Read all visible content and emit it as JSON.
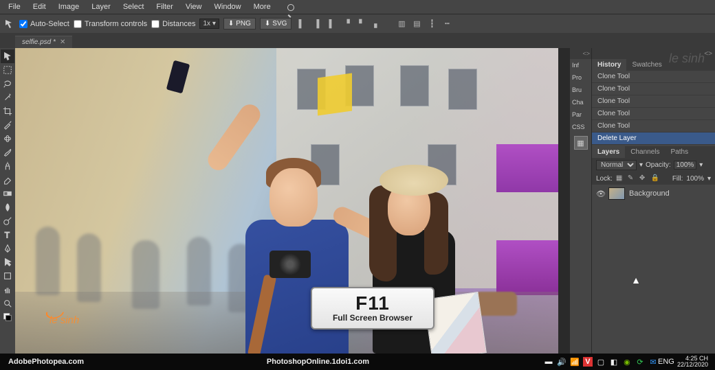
{
  "menu": {
    "items": [
      "File",
      "Edit",
      "Image",
      "Layer",
      "Select",
      "Filter",
      "View",
      "Window",
      "More"
    ]
  },
  "options": {
    "autoSelect": "Auto-Select",
    "transformControls": "Transform controls",
    "distances": "Distances",
    "scale": "1x",
    "png": "PNG",
    "svg": "SVG"
  },
  "tab": {
    "name": "selfie.psd",
    "dirty": "*",
    "close": "✕"
  },
  "collapsed": {
    "items": [
      "Inf",
      "Pro",
      "Bru",
      "Cha",
      "Par",
      "CSS"
    ]
  },
  "history": {
    "tabs": [
      "History",
      "Swatches"
    ],
    "items": [
      "Clone Tool",
      "Clone Tool",
      "Clone Tool",
      "Clone Tool",
      "Clone Tool",
      "Delete Layer"
    ]
  },
  "layers": {
    "tabs": [
      "Layers",
      "Channels",
      "Paths"
    ],
    "mode": "Normal",
    "opacityLabel": "Opacity:",
    "opacityVal": "100%",
    "lockLabel": "Lock:",
    "fillLabel": "Fill:",
    "fillVal": "100%",
    "items": [
      {
        "name": "Background"
      }
    ]
  },
  "overlay": {
    "key": "F11",
    "text": "Full Screen Browser"
  },
  "watermark": "le sinh",
  "logo": "le sinh",
  "taskbar": {
    "left": "AdobePhotopea.com",
    "center": "PhotoshopOnline.1doi1.com",
    "lang": "ENG",
    "time": "4:25 CH",
    "date": "22/12/2020"
  },
  "ui": {
    "expand": "<>",
    "drop": "▾"
  }
}
